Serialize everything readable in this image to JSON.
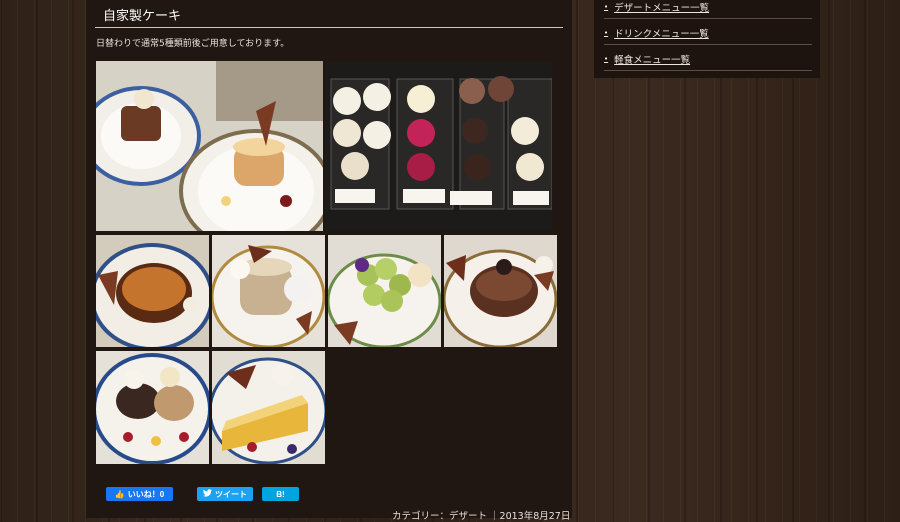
{
  "section": {
    "title": "自家製ケーキ",
    "description": "日替わりで通常5種類前後ご用意しております。"
  },
  "gallery": {
    "photos": [
      {
        "name": "plated-cakes-photo"
      },
      {
        "name": "cake-showcase-photo"
      },
      {
        "name": "creme-brulee-photo"
      },
      {
        "name": "cheesecake-photo"
      },
      {
        "name": "fruit-tart-photo"
      },
      {
        "name": "chocolate-cake-photo"
      },
      {
        "name": "dessert-plate-photo"
      },
      {
        "name": "fruit-cake-slice-photo"
      }
    ]
  },
  "share": {
    "like_label": "いいね！0",
    "tweet_label": "ツイート",
    "hatena_label": "B!"
  },
  "footer": {
    "meta": "カテゴリー：デザート ｜2013年8月27日"
  },
  "sidebar": {
    "items": [
      {
        "label": "デザートメニュー一覧"
      },
      {
        "label": "ドリンクメニュー一覧"
      },
      {
        "label": "軽食メニュー一覧"
      }
    ]
  },
  "colors": {
    "like": "#1877f2",
    "tweet": "#1da1f2",
    "hatena": "#00a4de"
  }
}
